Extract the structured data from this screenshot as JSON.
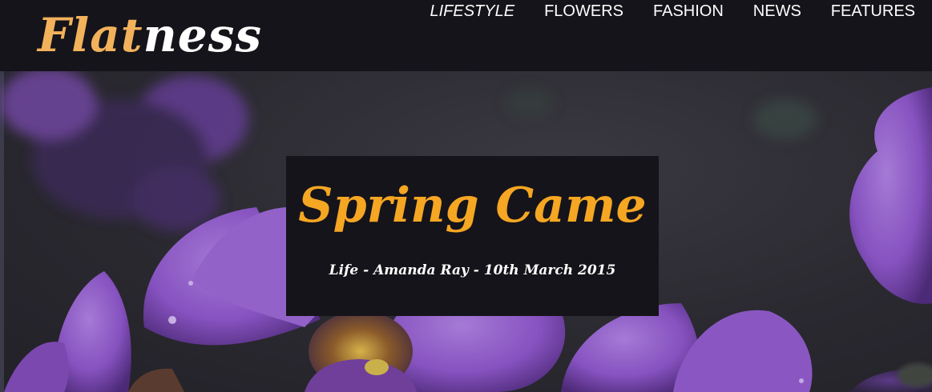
{
  "site": {
    "logo_accent": "Flat",
    "logo_rest": "ness"
  },
  "nav": {
    "items": [
      {
        "label": "LIFESTYLE",
        "active": true
      },
      {
        "label": "FLOWERS",
        "active": false
      },
      {
        "label": "FASHION",
        "active": false
      },
      {
        "label": "NEWS",
        "active": false
      },
      {
        "label": "FEATURES",
        "active": false
      }
    ]
  },
  "hero": {
    "image": "purple-flowers-photo",
    "title": "Spring Came",
    "meta": "Life - Amanda Ray - 10th March 2015"
  },
  "colors": {
    "header_bg": "#15141a",
    "logo_accent": "#f2b25c",
    "title": "#f5a623",
    "petal": "#8a55c2"
  }
}
